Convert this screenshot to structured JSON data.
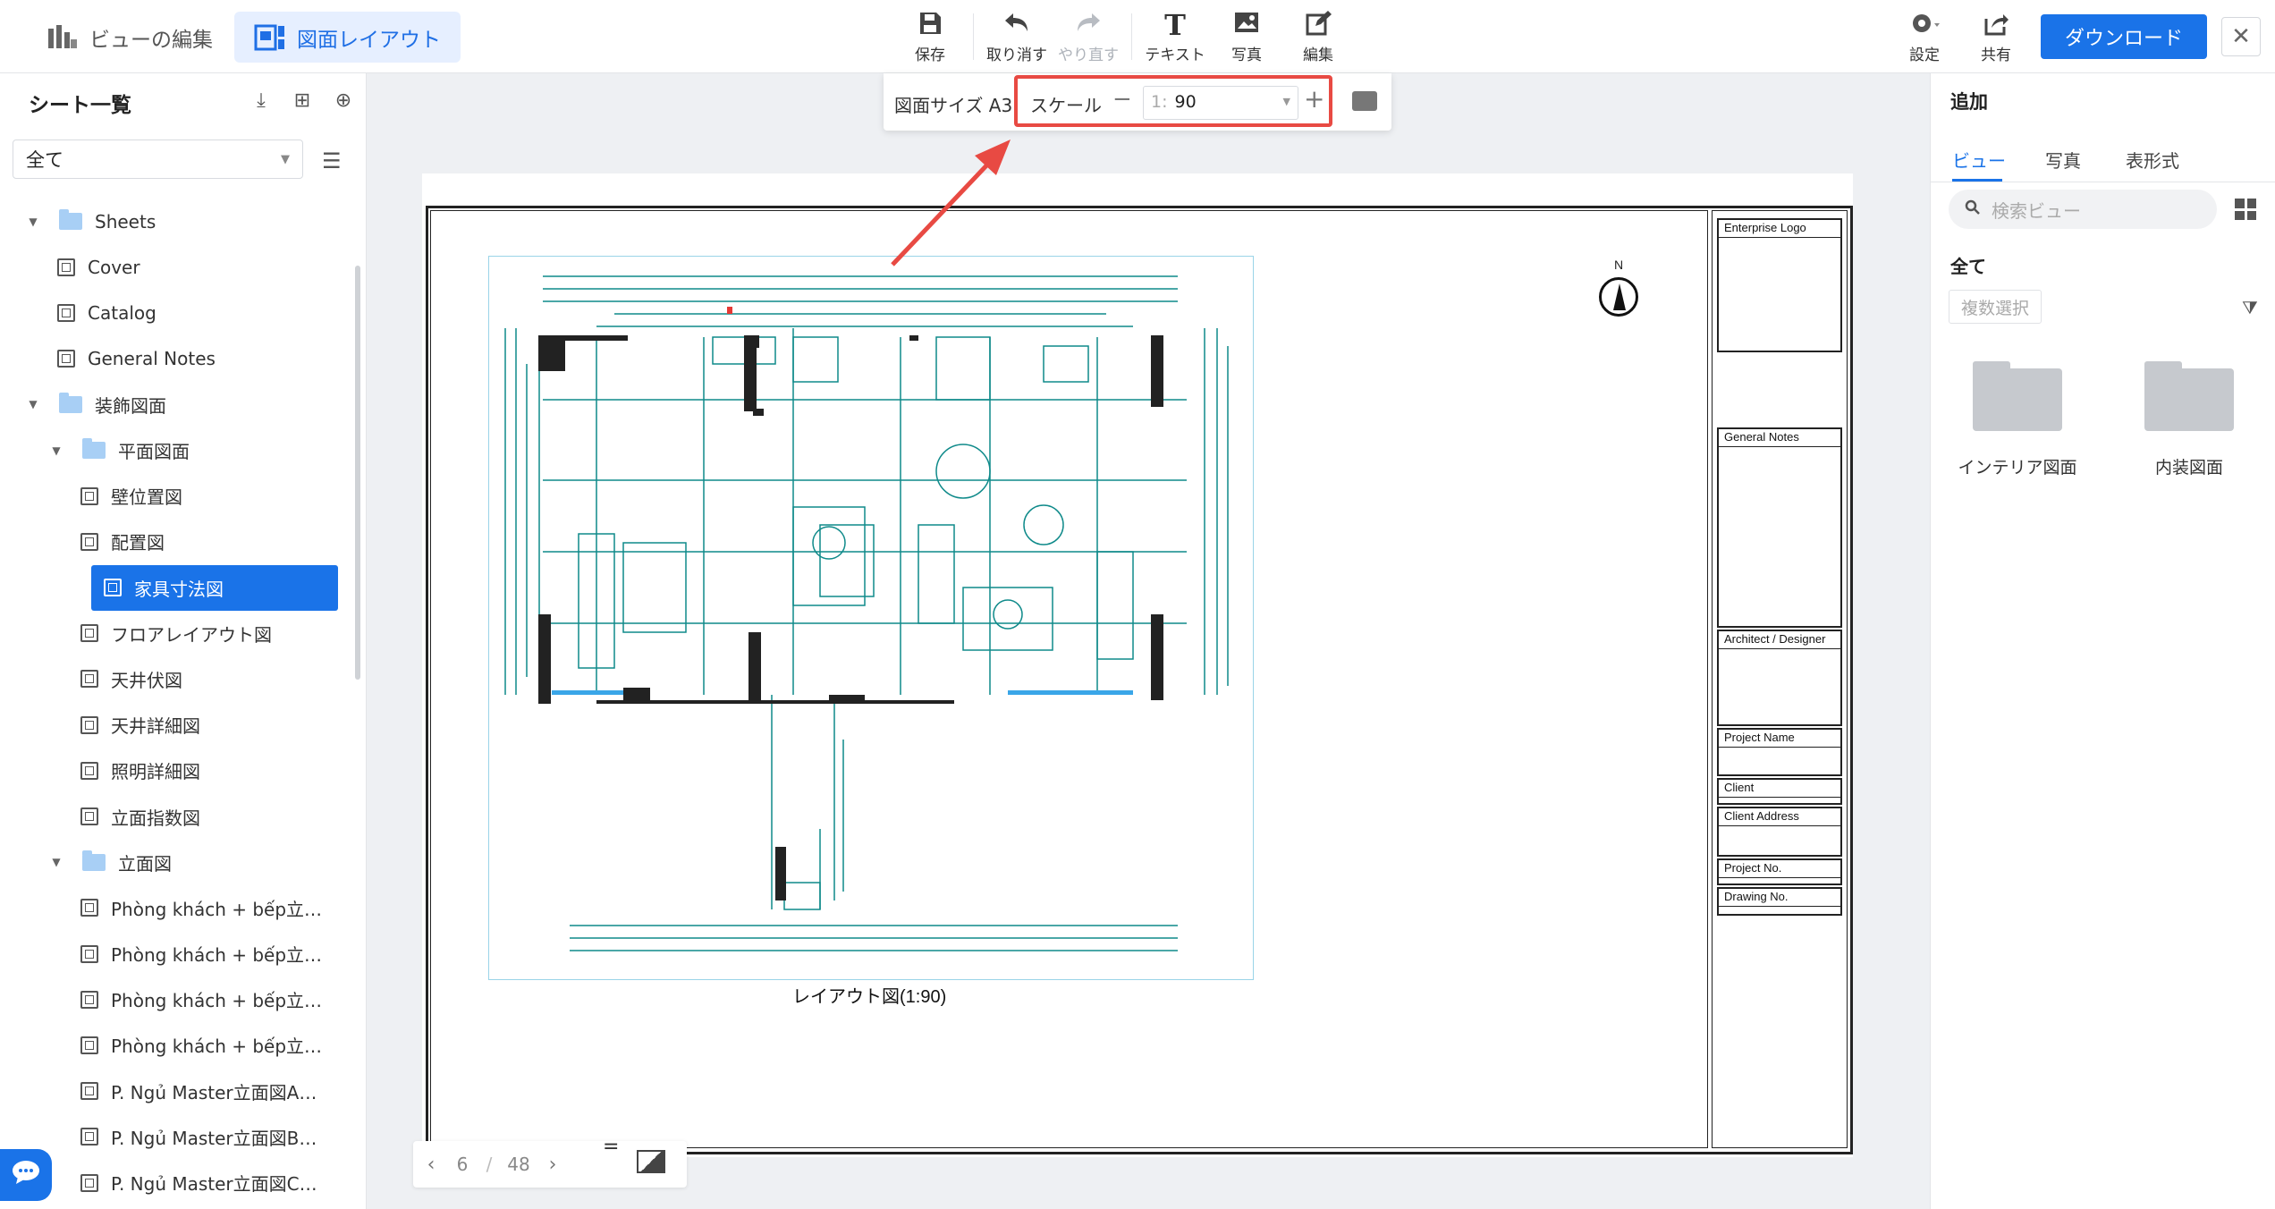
{
  "topbar": {
    "mode_edit": "ビューの編集",
    "mode_layout": "図面レイアウト",
    "tools": [
      {
        "label": "保存",
        "icon": "save-icon",
        "glyph": "🖫",
        "disabled": false
      },
      {
        "label": "取り消す",
        "icon": "undo-icon",
        "glyph": "↶",
        "disabled": false
      },
      {
        "label": "やり直す",
        "icon": "redo-icon",
        "glyph": "↷",
        "disabled": true
      },
      {
        "label": "テキスト",
        "icon": "text-icon",
        "glyph": "T",
        "disabled": false
      },
      {
        "label": "写真",
        "icon": "photo-icon",
        "glyph": "▣",
        "disabled": false
      },
      {
        "label": "編集",
        "icon": "edit-icon",
        "glyph": "✎",
        "disabled": false
      }
    ],
    "settings_label": "設定",
    "share_label": "共有",
    "download_label": "ダウンロード",
    "close_glyph": "✕"
  },
  "left_panel": {
    "title": "シート一覧",
    "filter_value": "全て",
    "tree": [
      {
        "label": "Sheets",
        "type": "folder",
        "level": 0,
        "expanded": true
      },
      {
        "label": "Cover",
        "type": "sheet",
        "level": 1
      },
      {
        "label": "Catalog",
        "type": "sheet",
        "level": 1
      },
      {
        "label": "General Notes",
        "type": "sheet",
        "level": 1
      },
      {
        "label": "装飾図面",
        "type": "folder",
        "level": 0,
        "expanded": true
      },
      {
        "label": "平面図面",
        "type": "folder",
        "level": 1,
        "expanded": true
      },
      {
        "label": "壁位置図",
        "type": "sheet",
        "level": 2
      },
      {
        "label": "配置図",
        "type": "sheet",
        "level": 2
      },
      {
        "label": "家具寸法図",
        "type": "sheet",
        "level": 2,
        "selected": true
      },
      {
        "label": "フロアレイアウト図",
        "type": "sheet",
        "level": 2
      },
      {
        "label": "天井伏図",
        "type": "sheet",
        "level": 2
      },
      {
        "label": "天井詳細図",
        "type": "sheet",
        "level": 2
      },
      {
        "label": "照明詳細図",
        "type": "sheet",
        "level": 2
      },
      {
        "label": "立面指数図",
        "type": "sheet",
        "level": 2
      },
      {
        "label": "立面図",
        "type": "folder",
        "level": 1,
        "expanded": true
      },
      {
        "label": "Phòng khách + bếp立…",
        "type": "sheet",
        "level": 2
      },
      {
        "label": "Phòng khách + bếp立…",
        "type": "sheet",
        "level": 2
      },
      {
        "label": "Phòng khách + bếp立…",
        "type": "sheet",
        "level": 2
      },
      {
        "label": "Phòng khách + bếp立…",
        "type": "sheet",
        "level": 2
      },
      {
        "label": "P. Ngủ Master立面図A…",
        "type": "sheet",
        "level": 2
      },
      {
        "label": "P. Ngủ Master立面図B…",
        "type": "sheet",
        "level": 2
      },
      {
        "label": "P. Ngủ Master立面図C…",
        "type": "sheet",
        "level": 2
      }
    ]
  },
  "scale_toolbar": {
    "size_label": "図面サイズ A3",
    "scale_label": "スケール",
    "scale_prefix": "1:",
    "scale_value": "90",
    "minus": "−",
    "plus": "+",
    "highlight_color": "#e84a43"
  },
  "drawing": {
    "caption": "レイアウト図(1:90)",
    "north_label": "N",
    "title_block": [
      {
        "label": "Enterprise Logo"
      },
      {
        "label": "General Notes"
      },
      {
        "label": "Architect / Designer"
      },
      {
        "label": "Project Name"
      },
      {
        "label": "Client"
      },
      {
        "label": "Client Address"
      },
      {
        "label": "Project No."
      },
      {
        "label": "Drawing No."
      }
    ],
    "plan_color": "#0f8a8a"
  },
  "pager": {
    "current": "6",
    "separator": "/",
    "total": "48",
    "menu_glyph": "="
  },
  "right_panel": {
    "title": "追加",
    "tabs": [
      "ビュー",
      "写真",
      "表形式"
    ],
    "search_placeholder": "検索ビュー",
    "all_label": "全て",
    "multi_select": "複数選択",
    "cards": [
      "インテリア図面",
      "内装図面"
    ]
  },
  "accent": "#1a73e8"
}
